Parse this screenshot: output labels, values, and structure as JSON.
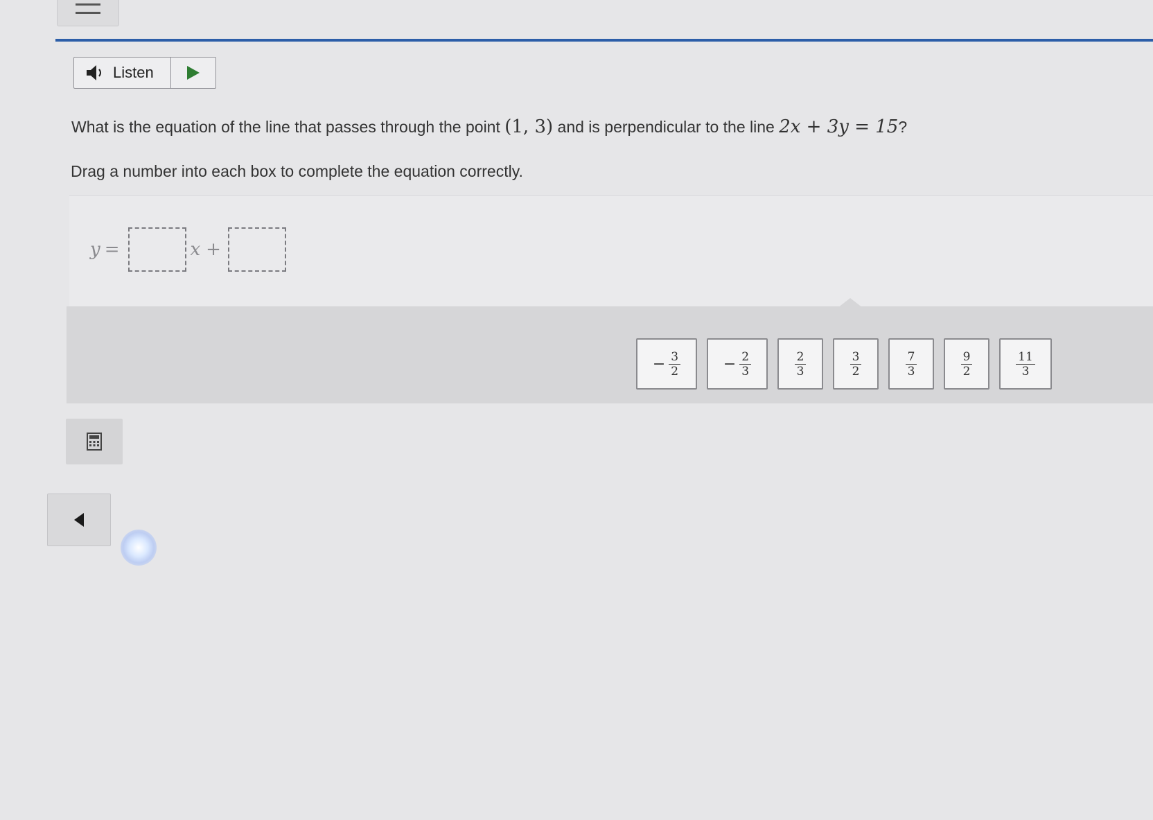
{
  "listen": {
    "label": "Listen"
  },
  "question": {
    "prefix": "What is the equation of the line that passes through the point",
    "point": "(1, 3)",
    "middle": "and is perpendicular to the line",
    "line_equation": "2x + 3y = 15",
    "suffix": "?"
  },
  "instruction": "Drag a number into each box to complete the equation correctly.",
  "equation": {
    "lhs": "y",
    "equals": "=",
    "x_term": "x",
    "plus": "+"
  },
  "tiles": [
    {
      "sign": "−",
      "numerator": "3",
      "denominator": "2"
    },
    {
      "sign": "−",
      "numerator": "2",
      "denominator": "3"
    },
    {
      "sign": "",
      "numerator": "2",
      "denominator": "3"
    },
    {
      "sign": "",
      "numerator": "3",
      "denominator": "2"
    },
    {
      "sign": "",
      "numerator": "7",
      "denominator": "3"
    },
    {
      "sign": "",
      "numerator": "9",
      "denominator": "2"
    },
    {
      "sign": "",
      "numerator": "11",
      "denominator": "3"
    }
  ],
  "icons": {
    "menu": "hamburger-icon",
    "listen": "speaker-icon",
    "play": "play-icon",
    "calculator": "calculator-icon",
    "back": "back-arrow-icon"
  },
  "colors": {
    "accent": "#2c5ea8",
    "play": "#2e7d32"
  }
}
